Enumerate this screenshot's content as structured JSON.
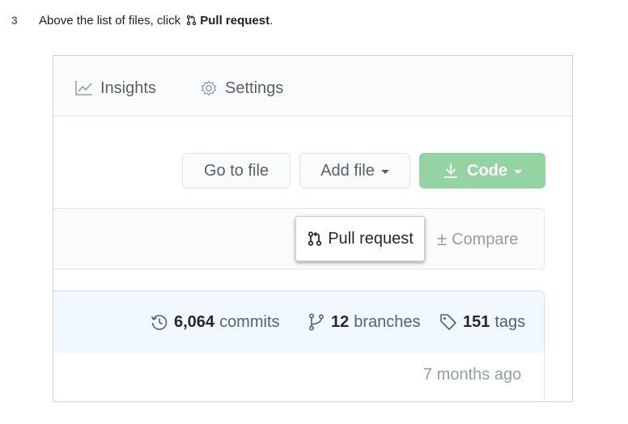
{
  "step": {
    "number": "3",
    "text_before": "Above the list of files, click",
    "bold_label": "Pull request",
    "text_after": "."
  },
  "nav": {
    "insights_label": "Insights",
    "settings_label": "Settings"
  },
  "toolbar": {
    "goto_file_label": "Go to file",
    "add_file_label": "Add file",
    "code_label": "Code",
    "code_color": "#94d3a2"
  },
  "compare_bar": {
    "pull_request_label": "Pull request",
    "compare_label": "Compare"
  },
  "stats": {
    "commits_count": "6,064",
    "commits_label": "commits",
    "branches_count": "12",
    "branches_label": "branches",
    "tags_count": "151",
    "tags_label": "tags"
  },
  "latest": {
    "time_ago": "7 months ago"
  },
  "icons": {
    "insights": "graph-icon",
    "settings": "gear-icon",
    "code": "download-icon",
    "pull_request": "git-pull-request-icon",
    "commits": "history-icon",
    "branches": "git-branch-icon",
    "tags": "tag-icon"
  }
}
